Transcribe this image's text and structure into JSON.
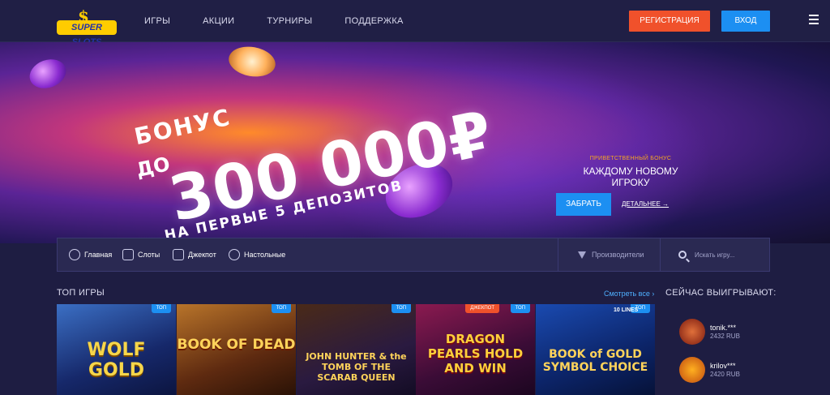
{
  "header": {
    "logo_text": "SUPER SLOTS",
    "logo_symbol": "$",
    "nav": [
      "ИГРЫ",
      "АКЦИИ",
      "ТУРНИРЫ",
      "ПОДДЕРЖКА"
    ],
    "register_label": "РЕГИСТРАЦИЯ",
    "login_label": "ВХОД"
  },
  "banner": {
    "line1": "БОНУС",
    "line2": "ДО",
    "amount": "300 000₽",
    "line3": "НА ПЕРВЫЕ 5 ДЕПОЗИТОВ",
    "kicker": "ПРИВЕТСТВЕННЫЙ БОНУС",
    "headline": "КАЖДОМУ НОВОМУ ИГРОКУ",
    "cta_label": "ЗАБРАТЬ",
    "more_label": "ДЕТАЛЬНЕЕ →"
  },
  "categories": [
    "Главная",
    "Слоты",
    "Джекпот",
    "Настольные"
  ],
  "providers_label": "Производители",
  "search_placeholder": "Искать игру...",
  "top_games": {
    "title": "ТОП ИГРЫ",
    "see_all": "Смотреть все ›",
    "games": [
      {
        "name": "WOLF GOLD",
        "badge": "ТОП"
      },
      {
        "name": "BOOK OF DEAD",
        "badge": "ТОП"
      },
      {
        "name": "JOHN HUNTER & the TOMB OF THE SCARAB QUEEN",
        "badge": "ТОП"
      },
      {
        "name": "DRAGON PEARLS HOLD AND WIN",
        "badge": "ТОП",
        "badge2": "ДЖЕКПОТ"
      },
      {
        "name": "BOOK of GOLD SYMBOL CHOICE",
        "badge": "ТОП",
        "extra": "10 LINES"
      }
    ]
  },
  "winners": {
    "title": "СЕЙЧАС ВЫИГРЫВАЮТ:",
    "items": [
      {
        "name": "tonik.***",
        "amount": "2432 RUB"
      },
      {
        "name": "krilov***",
        "amount": "2420 RUB"
      }
    ]
  },
  "colors": {
    "accent_orange": "#f0512b",
    "accent_blue": "#1c8ff2",
    "bg": "#1e1d42"
  }
}
